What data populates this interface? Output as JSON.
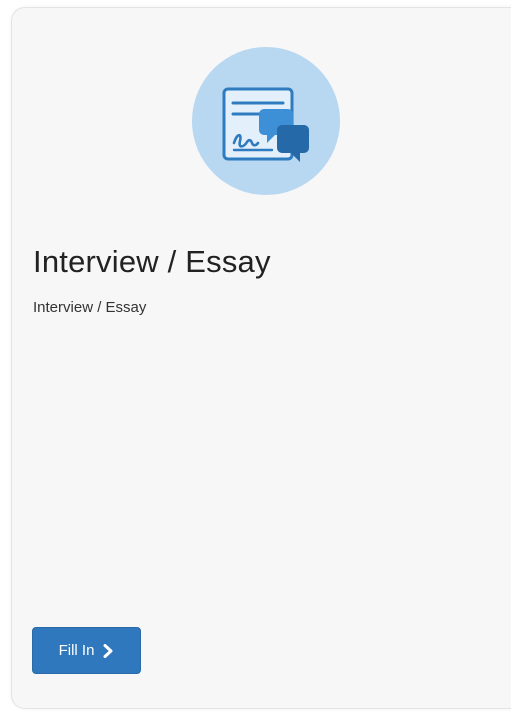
{
  "card": {
    "icon": "interview-document-chat-icon",
    "title": "Interview / Essay",
    "description": "Interview / Essay",
    "button": {
      "label": "Fill In",
      "icon": "chevron-right-icon"
    }
  },
  "colors": {
    "accent": "#2f78bd",
    "icon_circle": "#b8d7f1",
    "card_background": "#f7f7f8"
  }
}
